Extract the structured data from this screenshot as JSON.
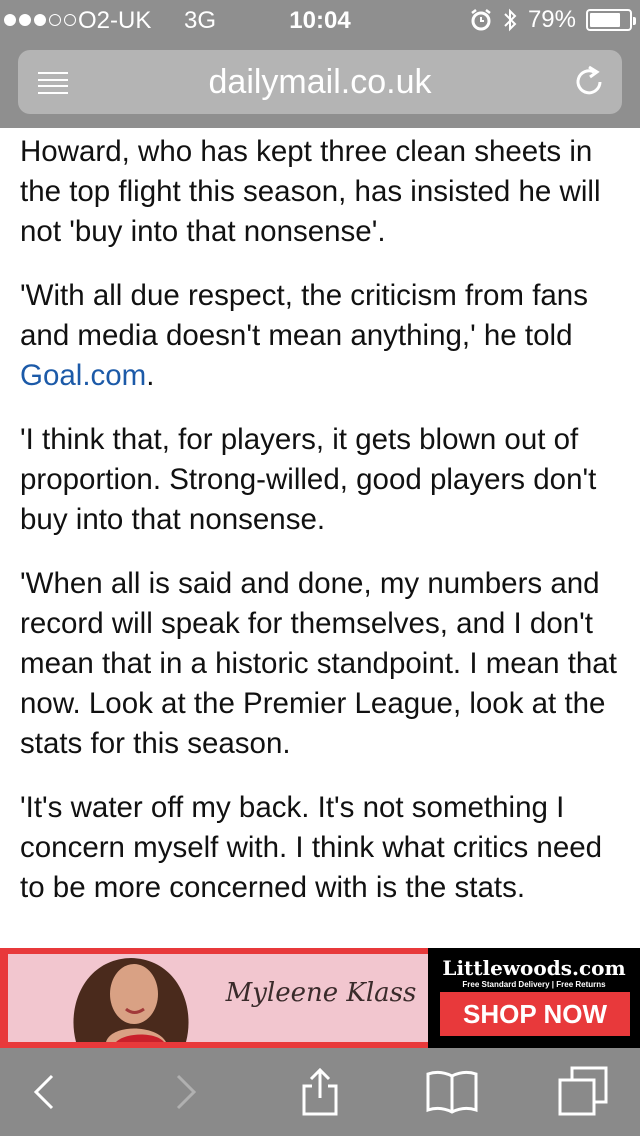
{
  "status_bar": {
    "signal_dots_filled": 3,
    "signal_dots_total": 5,
    "carrier": "O2-UK",
    "network": "3G",
    "time": "10:04",
    "alarm_icon": "alarm-clock-icon",
    "bluetooth_icon": "bluetooth-icon",
    "battery_percent_label": "79%",
    "battery_level": 0.79
  },
  "browser": {
    "url": "dailymail.co.uk",
    "reader_icon": "reader-view-icon",
    "reload_icon": "reload-icon"
  },
  "article": {
    "paragraphs": [
      "Howard, who has kept three clean sheets in the top flight this season, has insisted he will not 'buy into that nonsense'.",
      {
        "before_link": "'With all due respect, the criticism from fans and media doesn't mean anything,' he told ",
        "link_text": "Goal.com",
        "after_link": "."
      },
      "'I think that, for players, it gets blown out of proportion. Strong-willed, good players don't buy into that nonsense.",
      "'When all is said and done, my numbers and record will speak for themselves, and I don't mean that in a historic standpoint. I mean that now. Look at the Premier League, look at the stats for this season.",
      "'It's water off my back. It's not something I concern myself with. I think what critics need to be more concerned with is the stats."
    ]
  },
  "ad": {
    "person_name": "Myleene Klass",
    "brand": "Littlewoods.com",
    "tagline": "Free Standard Delivery | Free Returns",
    "cta": "SHOP NOW",
    "colors": {
      "banner_red": "#e8393b",
      "panel_pink": "#f2c6cf",
      "panel_black": "#000000"
    }
  },
  "toolbar": {
    "items": [
      "back-icon",
      "forward-icon",
      "share-icon",
      "bookmarks-icon",
      "tabs-icon"
    ]
  },
  "colors": {
    "chrome_gray": "#8f8f8f",
    "link_blue": "#1c5aa8"
  }
}
